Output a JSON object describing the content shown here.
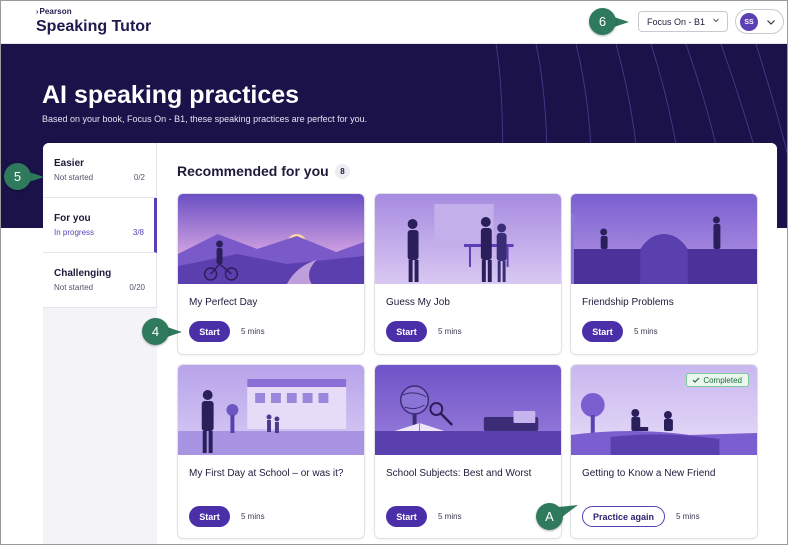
{
  "brand": {
    "company": "Pearson",
    "app_title": "Speaking Tutor"
  },
  "header": {
    "course_select": "Focus On - B1",
    "user_initials": "SS"
  },
  "hero": {
    "title": "AI speaking practices",
    "subtitle": "Based on your book, Focus On - B1, these speaking practices are perfect for you."
  },
  "levels": [
    {
      "name": "Easier",
      "status": "Not started",
      "count": "0/2"
    },
    {
      "name": "For you",
      "status": "In progress",
      "count": "3/8"
    },
    {
      "name": "Challenging",
      "status": "Not started",
      "count": "0/20"
    }
  ],
  "recommended": {
    "title": "Recommended for you",
    "count": "8",
    "cards": [
      {
        "title": "My Perfect Day",
        "action": "Start",
        "duration": "5 mins"
      },
      {
        "title": "Guess My Job",
        "action": "Start",
        "duration": "5 mins"
      },
      {
        "title": "Friendship Problems",
        "action": "Start",
        "duration": "5 mins"
      },
      {
        "title": "My First Day at School – or was it?",
        "action": "Start",
        "duration": "5 mins"
      },
      {
        "title": "School Subjects: Best and Worst",
        "action": "Start",
        "duration": "5 mins"
      },
      {
        "title": "Getting to Know a New Friend",
        "action": "Practice again",
        "duration": "5 mins",
        "badge": "Completed"
      }
    ]
  },
  "callouts": {
    "c6": "6",
    "c5": "5",
    "c4": "4",
    "cA": "A"
  },
  "colors": {
    "accent": "#4b2fa8",
    "hero_bg": "#1a1248",
    "callout": "#2f7a5c"
  }
}
